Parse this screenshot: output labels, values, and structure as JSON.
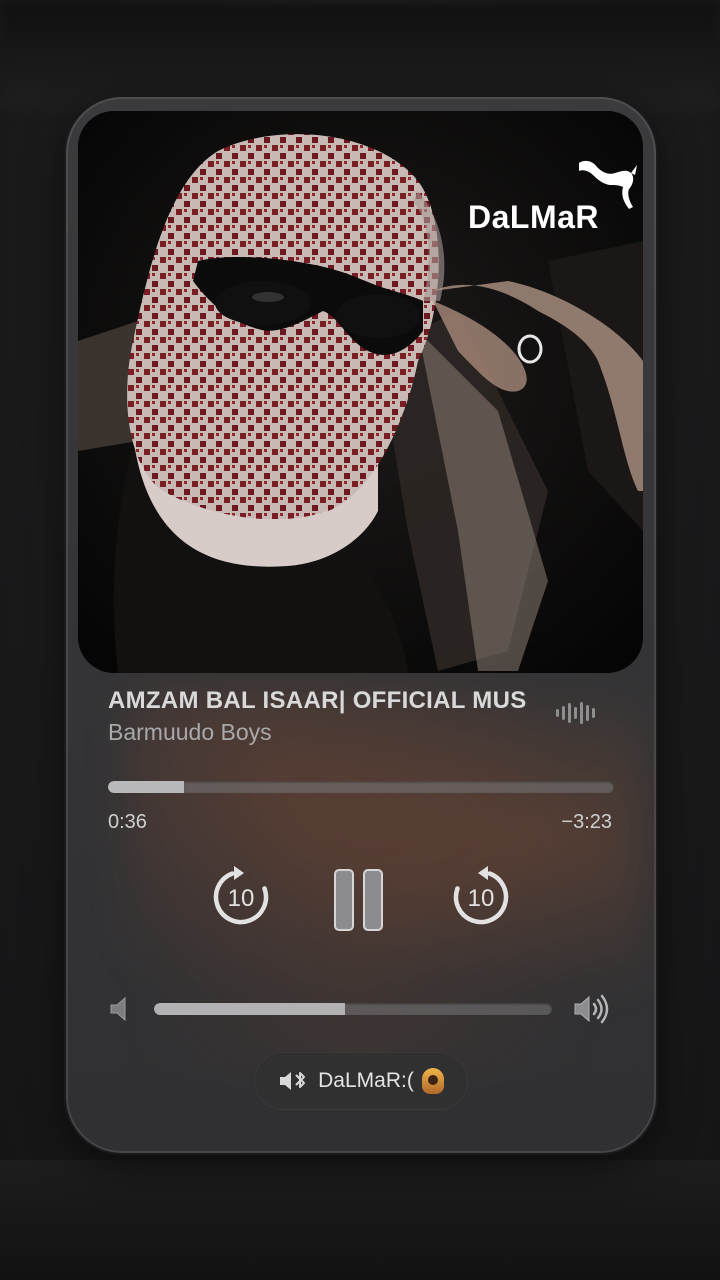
{
  "artwork": {
    "watermark_text": "DaLMaR",
    "logo_icon": "puma-cat-icon"
  },
  "now_playing": {
    "title": "AMZAM BAL ISAAR| OFFICIAL MUSIC",
    "artist": "Barmuudo Boys"
  },
  "playback": {
    "elapsed": "0:36",
    "remaining": "−3:23",
    "progress_fraction": 0.15
  },
  "controls": {
    "skip_back_seconds": "10",
    "skip_forward_seconds": "10",
    "state": "playing"
  },
  "volume": {
    "level_fraction": 0.48
  },
  "output_device": {
    "label": "DaLMaR:(",
    "icon": "speaker-bluetooth-icon"
  },
  "colors": {
    "card": "#353537",
    "accent_text": "#d9d9da",
    "progress_fill": "#b9b9bb"
  }
}
